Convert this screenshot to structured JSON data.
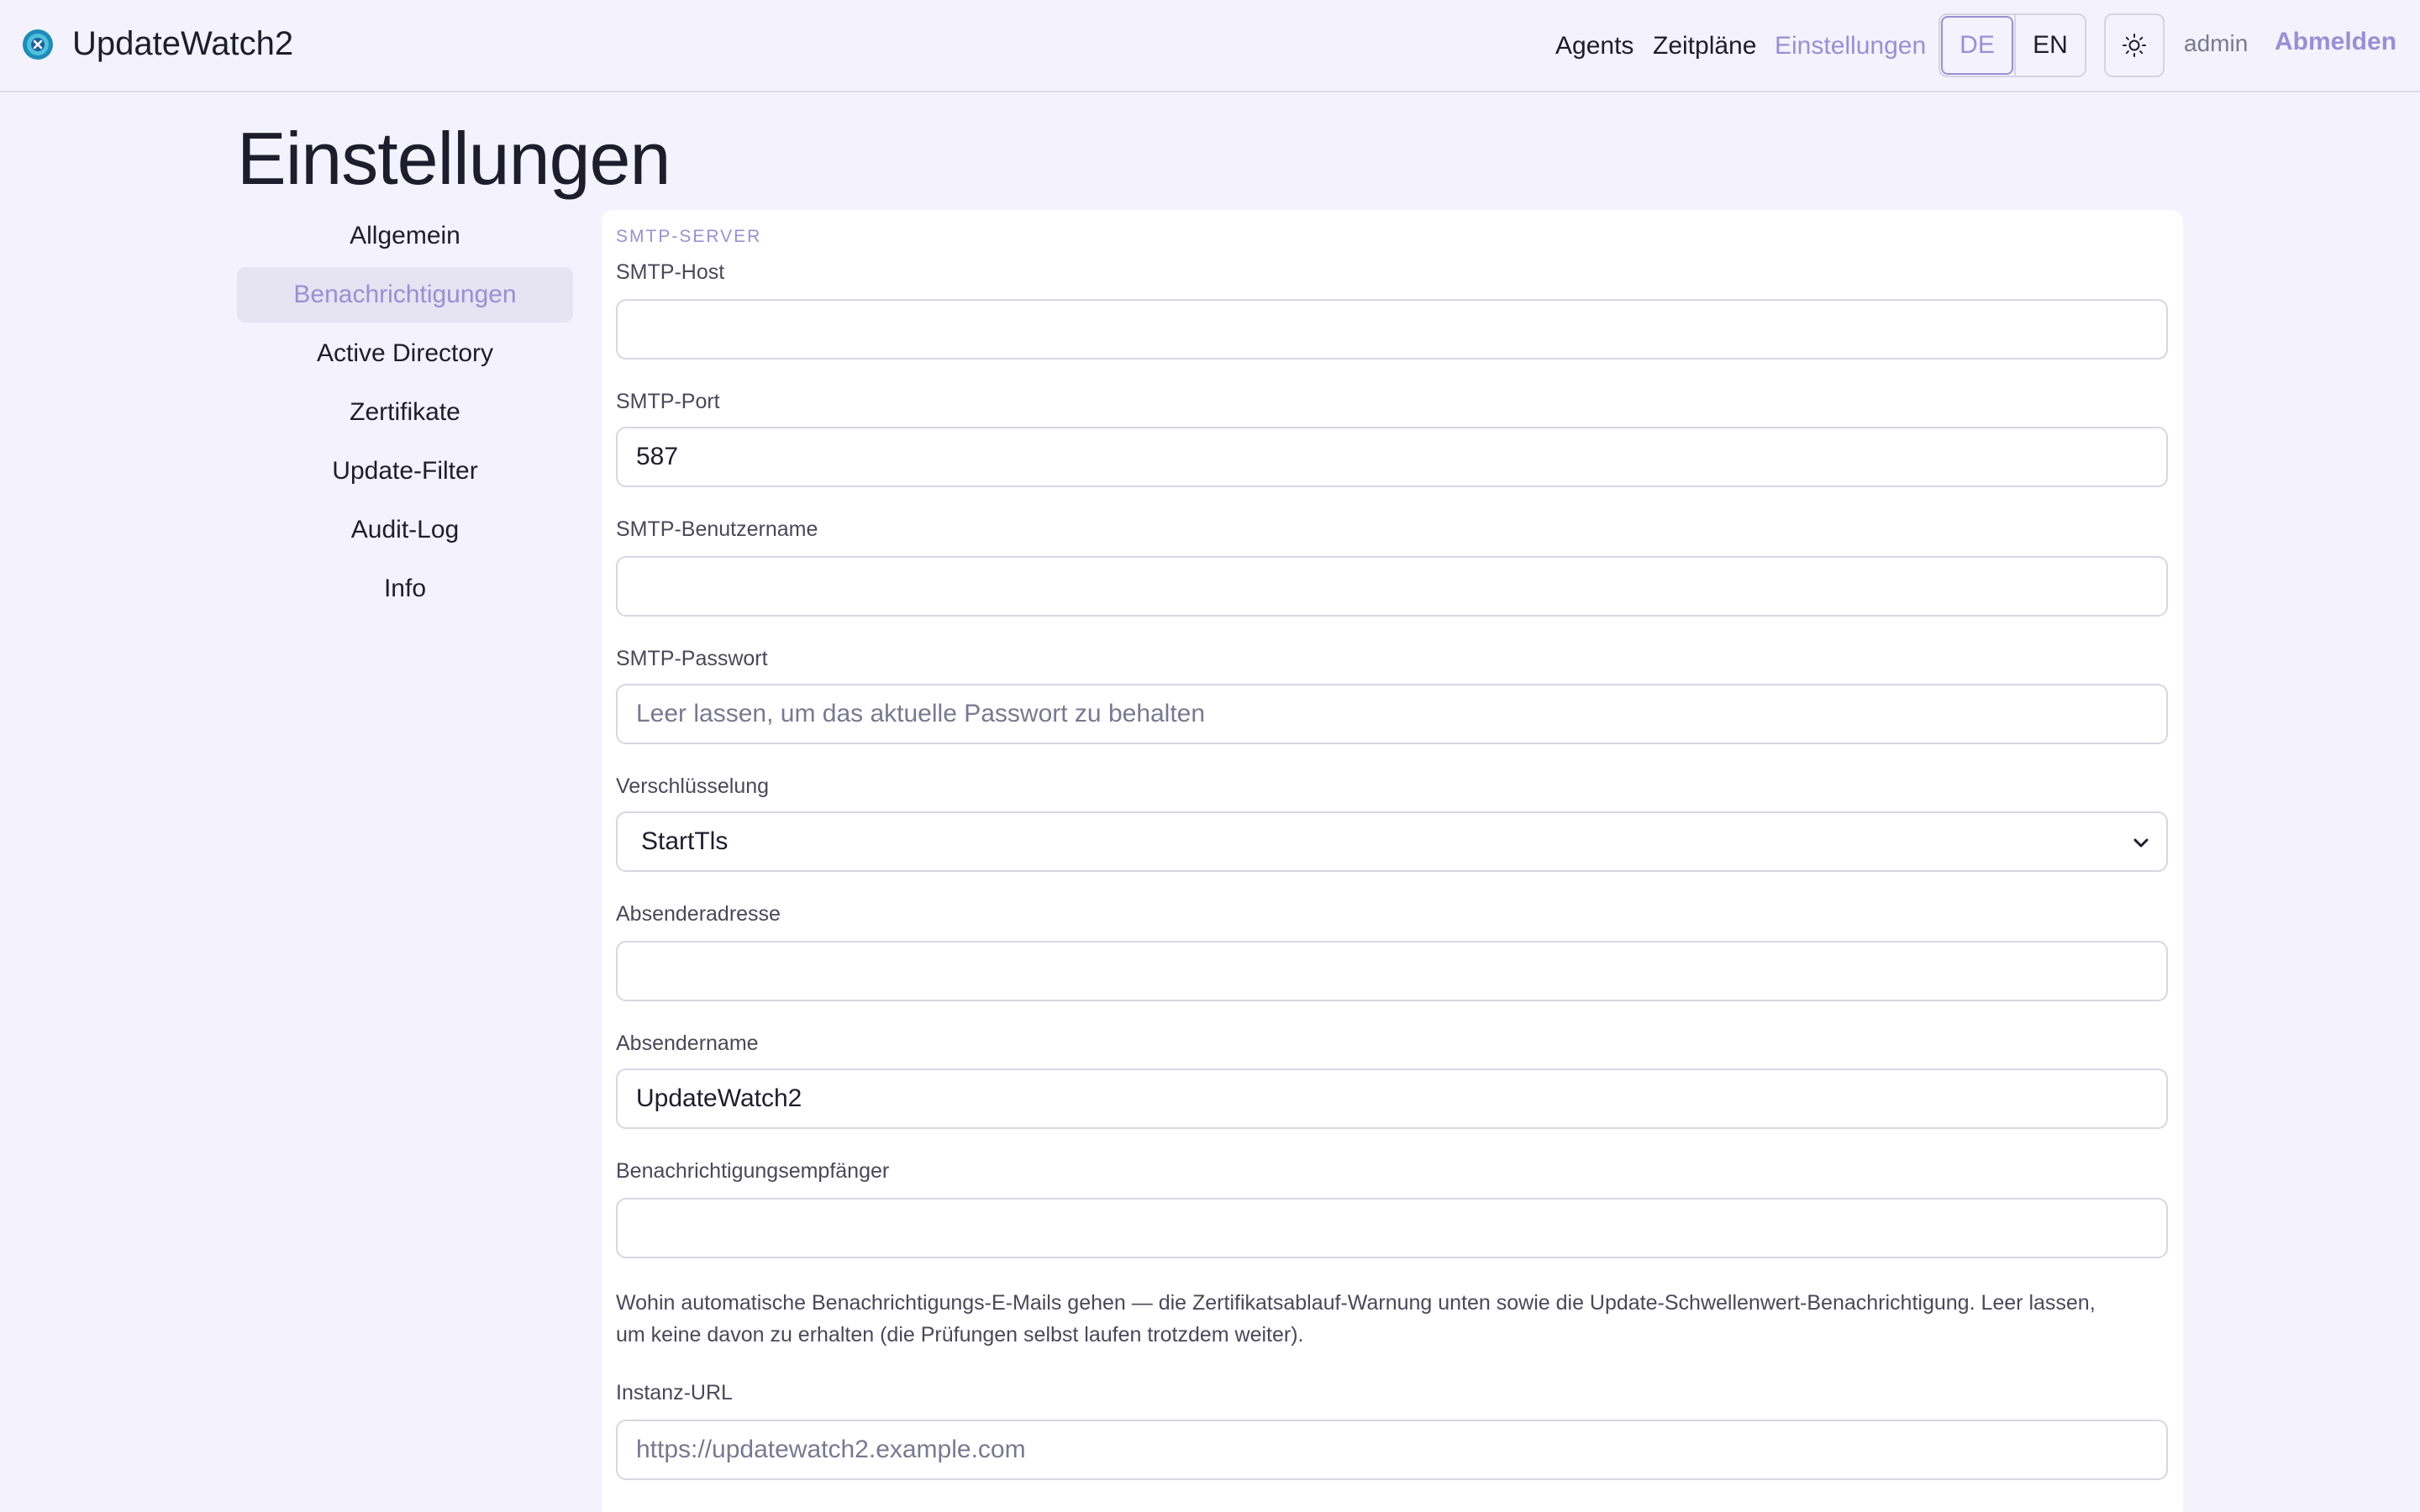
{
  "app": {
    "name": "UpdateWatch2"
  },
  "nav": {
    "agents": "Agents",
    "schedules": "Zeitpläne",
    "settings": "Einstellungen"
  },
  "lang": {
    "de": "DE",
    "en": "EN"
  },
  "user": {
    "name": "admin",
    "logout": "Abmelden"
  },
  "page": {
    "title": "Einstellungen"
  },
  "sidebar": {
    "items": [
      {
        "label": "Allgemein"
      },
      {
        "label": "Benachrichtigungen"
      },
      {
        "label": "Active Directory"
      },
      {
        "label": "Zertifikate"
      },
      {
        "label": "Update-Filter"
      },
      {
        "label": "Audit-Log"
      },
      {
        "label": "Info"
      }
    ]
  },
  "smtp": {
    "section": "SMTP-SERVER",
    "host": {
      "label": "SMTP-Host",
      "value": "",
      "placeholder": ""
    },
    "port": {
      "label": "SMTP-Port",
      "value": "587"
    },
    "username": {
      "label": "SMTP-Benutzername",
      "value": ""
    },
    "password": {
      "label": "SMTP-Passwort",
      "value": "",
      "placeholder": "Leer lassen, um das aktuelle Passwort zu behalten"
    },
    "encryption": {
      "label": "Verschlüsselung",
      "value": "StartTls"
    },
    "from_address": {
      "label": "Absenderadresse",
      "value": ""
    },
    "from_name": {
      "label": "Absendername",
      "value": "UpdateWatch2"
    },
    "recipients": {
      "label": "Benachrichtigungsempfänger",
      "value": ""
    },
    "recipients_help": "Wohin automatische Benachrichtigungs-E-Mails gehen — die Zertifikatsablauf-Warnung unten sowie die Update-Schwellenwert-Benachrichtigung. Leer lassen, um keine davon zu erhalten (die Prüfungen selbst laufen trotzdem weiter).",
    "instance_url": {
      "label": "Instanz-URL",
      "value": "",
      "placeholder": "https://updatewatch2.example.com"
    }
  },
  "colors": {
    "accent": "#9a8fd2",
    "background": "#f4f2fc",
    "text": "#1e1d2b"
  }
}
